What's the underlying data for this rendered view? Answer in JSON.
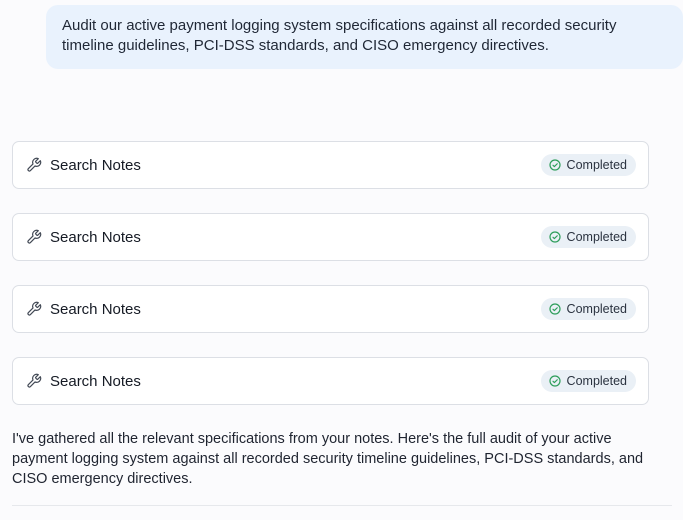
{
  "user_message": {
    "text": "Audit our active payment logging system specifications against all recorded security timeline guidelines, PCI-DSS standards, and CISO emergency directives."
  },
  "tool_calls": [
    {
      "label": "Search Notes",
      "status": "Completed",
      "icon": "wrench-icon",
      "status_icon": "check-circle-icon"
    },
    {
      "label": "Search Notes",
      "status": "Completed",
      "icon": "wrench-icon",
      "status_icon": "check-circle-icon"
    },
    {
      "label": "Search Notes",
      "status": "Completed",
      "icon": "wrench-icon",
      "status_icon": "check-circle-icon"
    },
    {
      "label": "Search Notes",
      "status": "Completed",
      "icon": "wrench-icon",
      "status_icon": "check-circle-icon"
    }
  ],
  "assistant_message": {
    "text": "I've gathered all the relevant specifications from your notes. Here's the full audit of your active payment logging system against all recorded security timeline guidelines, PCI-DSS standards, and CISO emergency directives."
  },
  "colors": {
    "user_bubble_bg": "#e9f2fd",
    "status_badge_bg": "#eaf0f6",
    "status_success": "#2e9e5b",
    "card_border": "#dcdfe5"
  }
}
